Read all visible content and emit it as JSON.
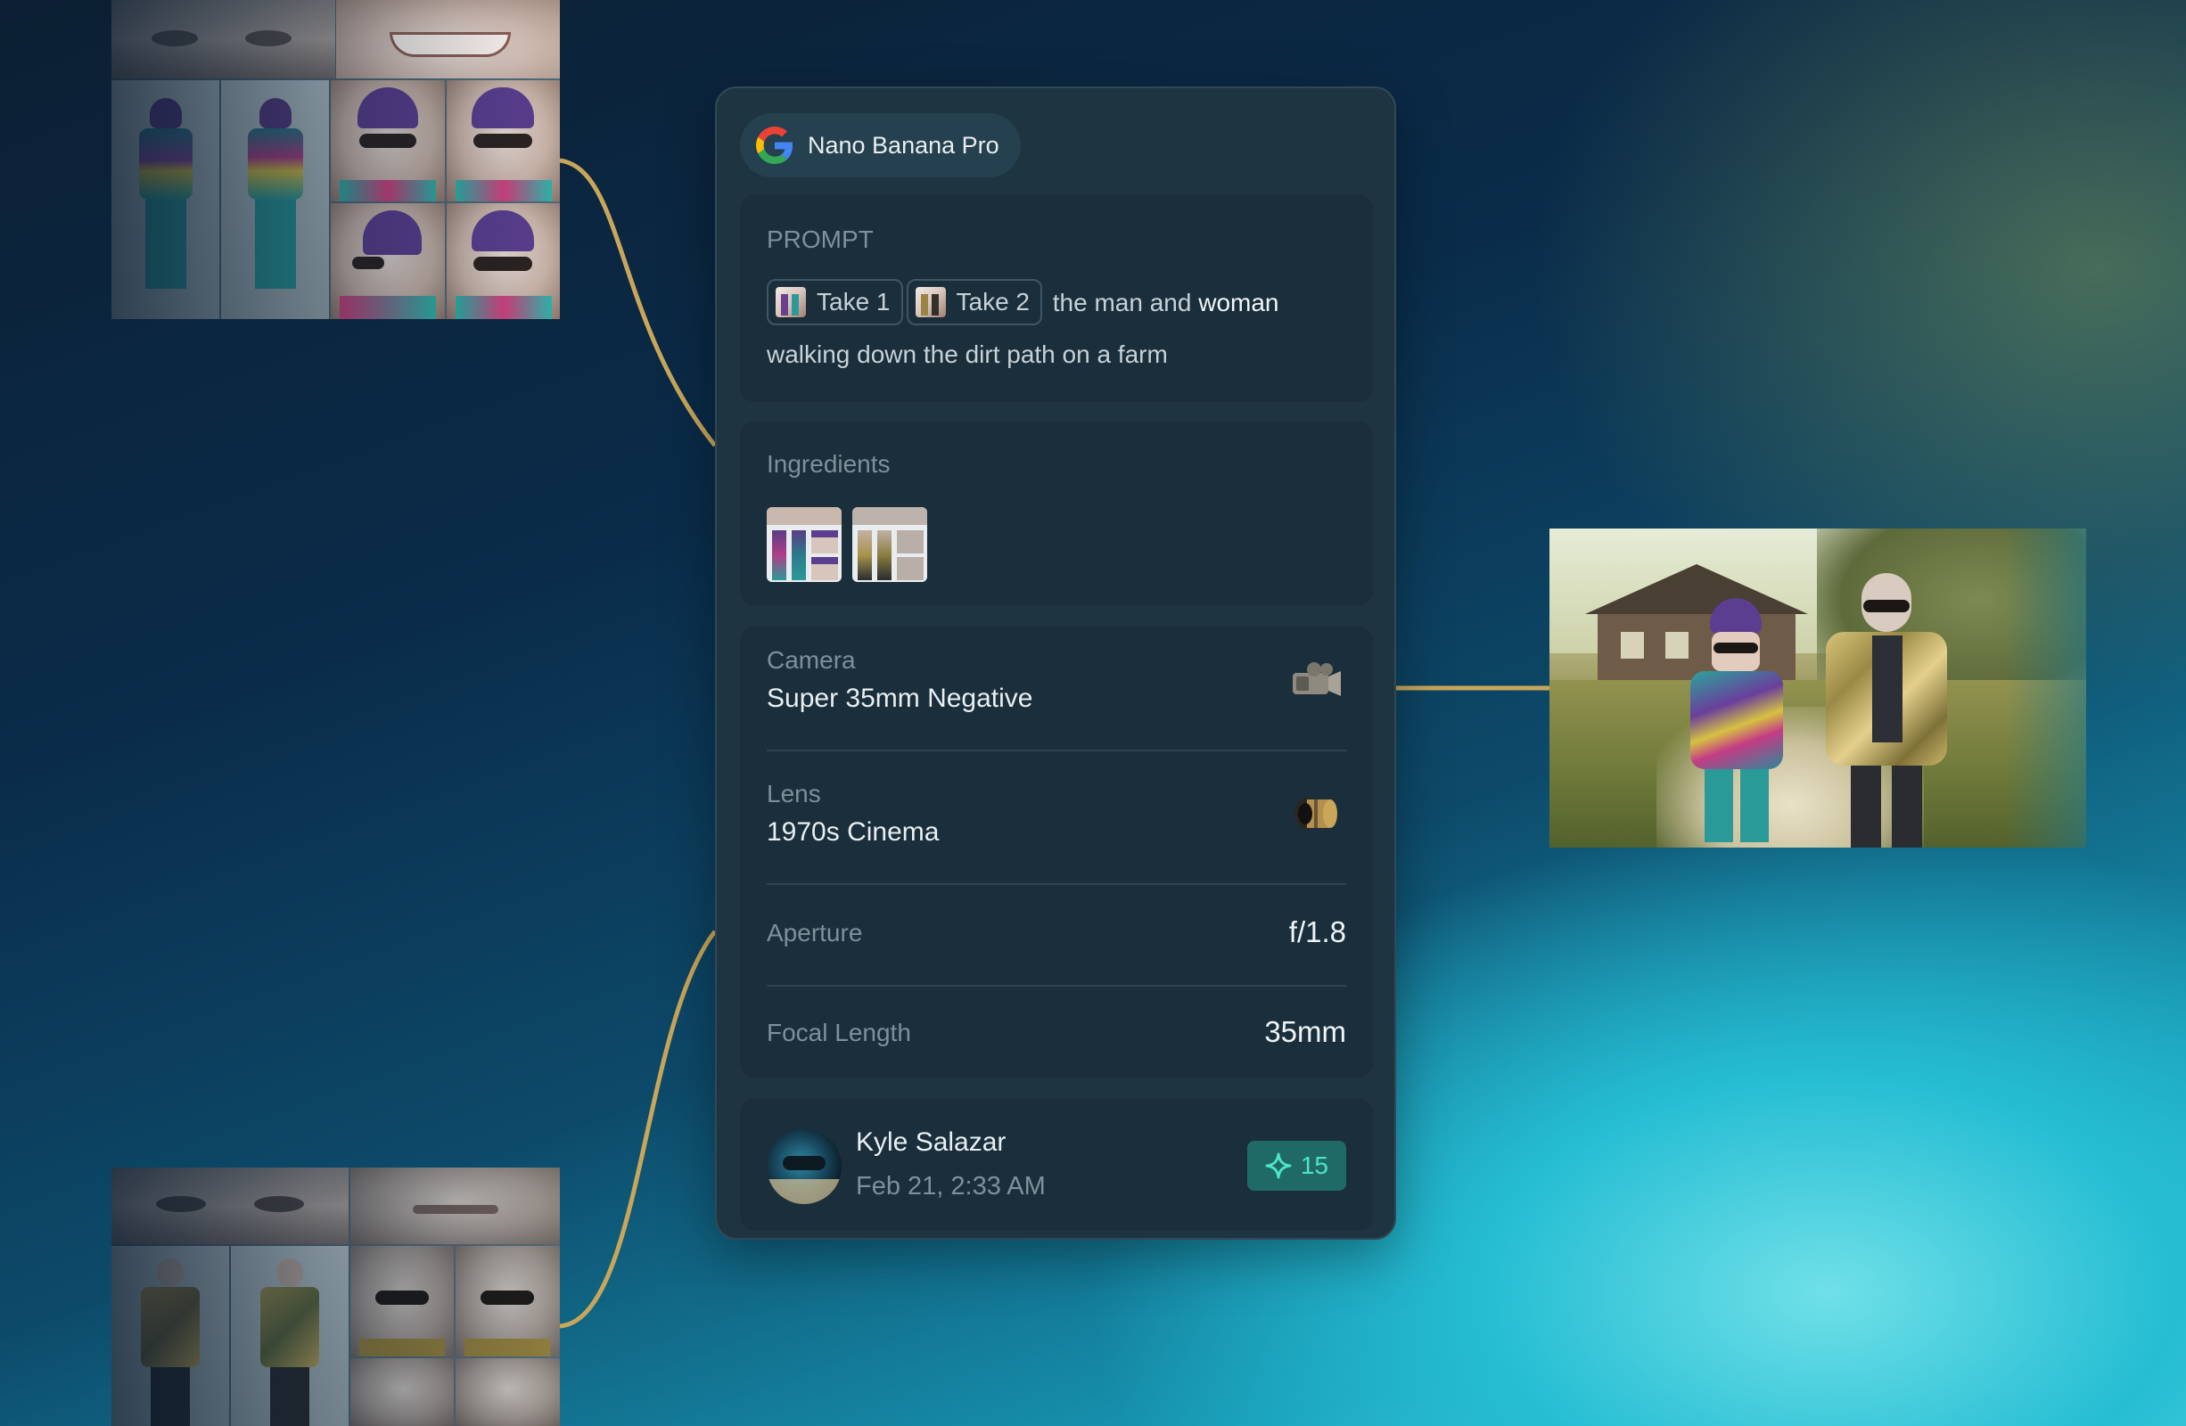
{
  "model": {
    "name": "Nano Banana Pro",
    "logo_icon": "google-g-icon"
  },
  "prompt": {
    "label": "PROMPT",
    "chips": [
      {
        "label": "Take 1"
      },
      {
        "label": "Take 2"
      }
    ],
    "text_plain": "the man and",
    "text_emphasis": "woman",
    "text_rest": "walking down the dirt path on a farm"
  },
  "ingredients": {
    "label": "Ingredients",
    "count": 2
  },
  "camera": {
    "label": "Camera",
    "value": "Super 35mm Negative",
    "icon": "film-camera-icon"
  },
  "lens": {
    "label": "Lens",
    "value": "1970s Cinema",
    "icon": "lens-icon"
  },
  "aperture": {
    "label": "Aperture",
    "value": "f/1.8"
  },
  "focal_length": {
    "label": "Focal Length",
    "value": "35mm"
  },
  "author": {
    "name": "Kyle Salazar",
    "date": "Feb 21, 2:33 AM"
  },
  "credits": {
    "value": "15",
    "icon": "sparkle-icon"
  },
  "colors": {
    "accent": "#4fe3c8",
    "wire": "#c9a65a",
    "panel": "#1f3441",
    "card": "#1a2e3b"
  }
}
